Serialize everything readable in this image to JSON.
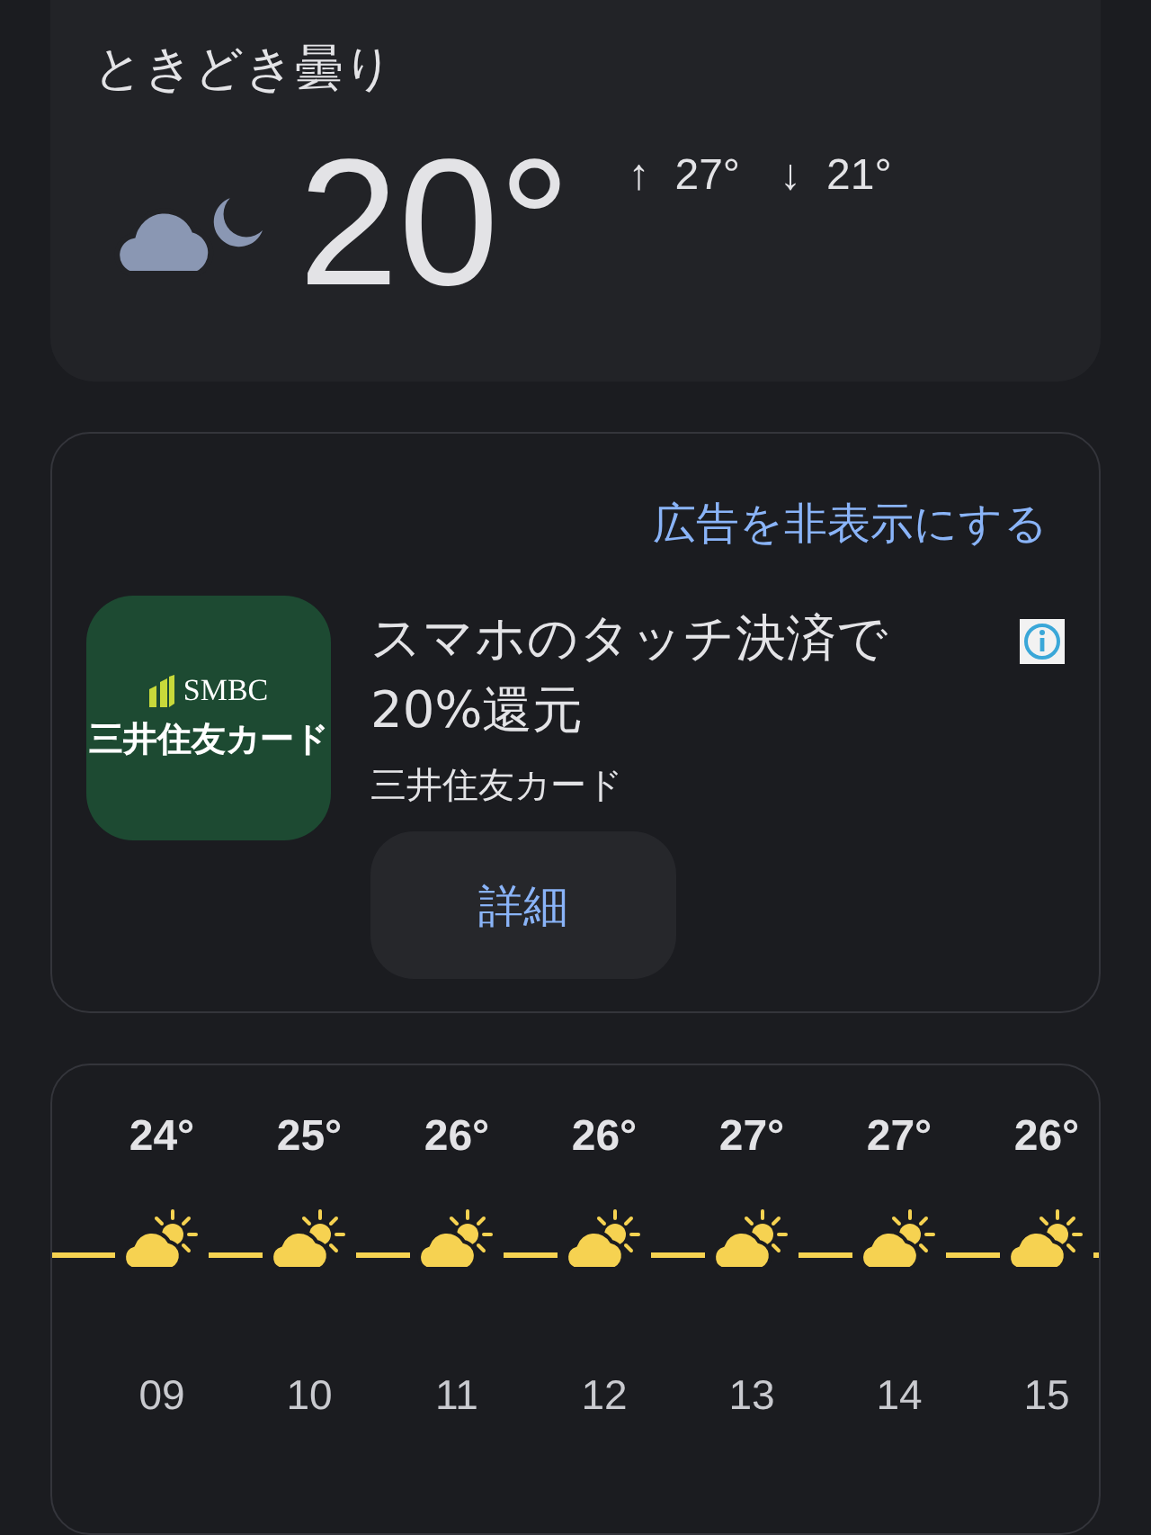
{
  "current": {
    "condition": "ときどき曇り",
    "temperature": "20°",
    "high_arrow": "↑",
    "high": "27°",
    "low_arrow": "↓",
    "low": "21°"
  },
  "ad": {
    "hide_link": "広告を非表示にする",
    "logo_brand": "SMBC",
    "logo_name": "三井住友カード",
    "headline": "スマホのタッチ決済で20%還元",
    "advertiser": "三井住友カード",
    "button": "詳細"
  },
  "hourly": [
    {
      "temp": "24°",
      "hour": "09"
    },
    {
      "temp": "25°",
      "hour": "10"
    },
    {
      "temp": "26°",
      "hour": "11"
    },
    {
      "temp": "26°",
      "hour": "12"
    },
    {
      "temp": "27°",
      "hour": "13"
    },
    {
      "temp": "27°",
      "hour": "14"
    },
    {
      "temp": "26°",
      "hour": "15"
    }
  ]
}
